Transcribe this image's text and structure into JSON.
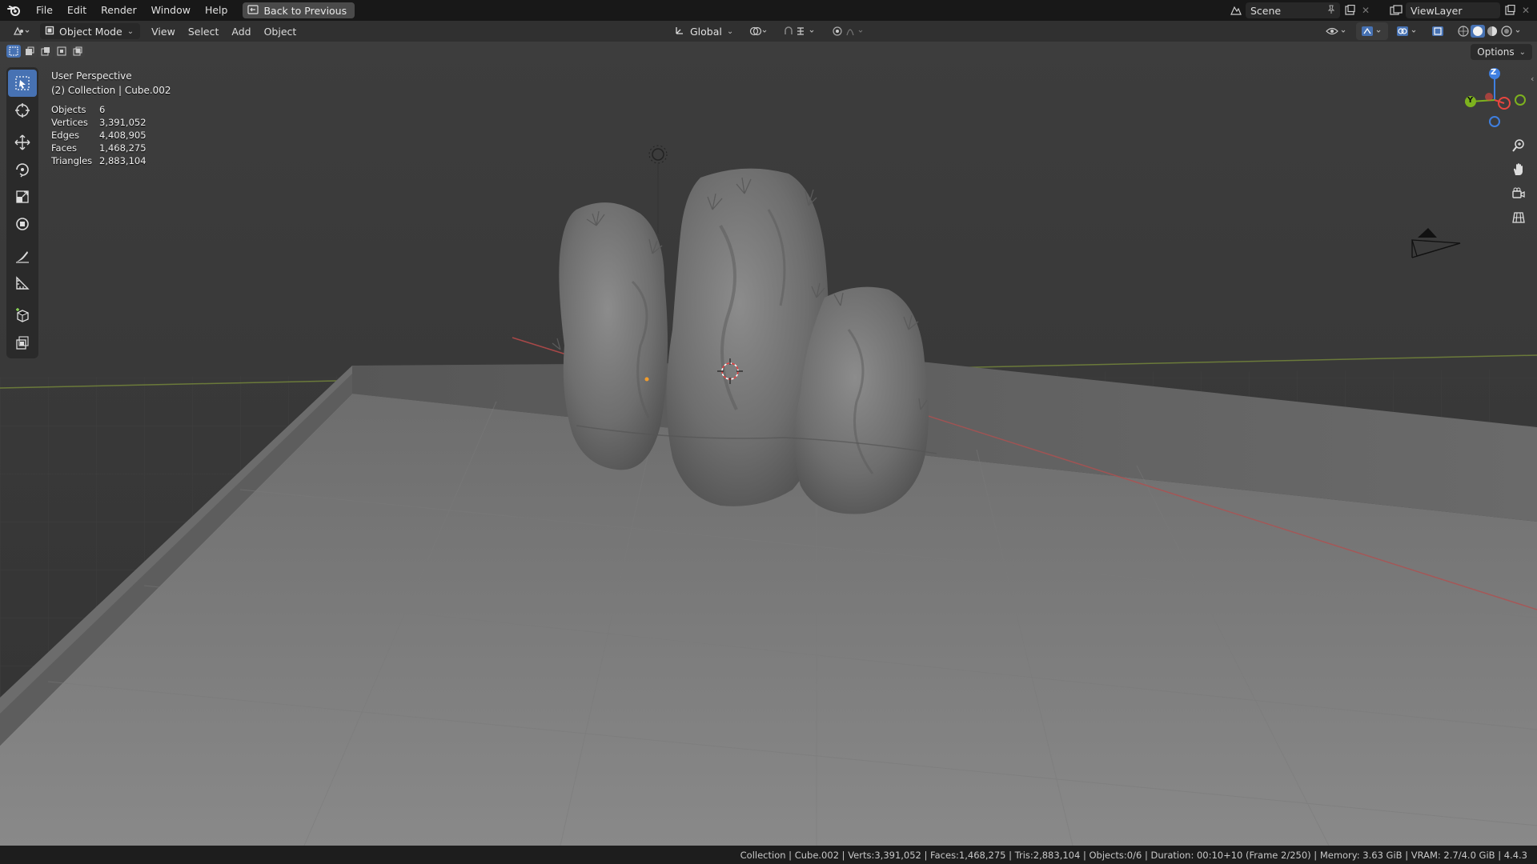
{
  "menu": {
    "items": [
      "File",
      "Edit",
      "Render",
      "Window",
      "Help"
    ],
    "back_label": "Back to Previous"
  },
  "topright": {
    "scene": "Scene",
    "viewlayer": "ViewLayer"
  },
  "header": {
    "mode": "Object Mode",
    "menus": [
      "View",
      "Select",
      "Add",
      "Object"
    ],
    "transform_orientation": "Global"
  },
  "viewport": {
    "perspective": "User Perspective",
    "collection_line": "(2) Collection | Cube.002",
    "options_label": "Options",
    "stats": [
      {
        "label": "Objects",
        "value": "6"
      },
      {
        "label": "Vertices",
        "value": "3,391,052"
      },
      {
        "label": "Edges",
        "value": "4,408,905"
      },
      {
        "label": "Faces",
        "value": "1,468,275"
      },
      {
        "label": "Triangles",
        "value": "2,883,104"
      }
    ],
    "gizmo": {
      "z": "Z",
      "y": "Y"
    }
  },
  "status": {
    "text": "Collection | Cube.002 | Verts:3,391,052 | Faces:1,468,275 | Tris:2,883,104 | Objects:0/6 | Duration: 00:10+10 (Frame 2/250) | Memory: 3.63 GiB | VRAM: 2.7/4.0 GiB | 4.4.3"
  },
  "colors": {
    "accent": "#4772b3",
    "x_axis": "#e8463f",
    "y_axis": "#7db21e",
    "z_axis": "#3f7fe0"
  },
  "icons": [
    "blender-logo-icon",
    "back-icon",
    "editor-type-icon",
    "object-mode-icon",
    "global-axis-icon",
    "pivot-icon",
    "snap-icon",
    "proportional-icon",
    "select-box-icon",
    "cursor-icon",
    "move-icon",
    "rotate-icon",
    "scale-icon",
    "transform-icon",
    "annotate-icon",
    "measure-icon",
    "add-cube-icon",
    "extrude-icon",
    "zoom-icon",
    "hand-icon",
    "camera-icon",
    "grid-icon"
  ]
}
